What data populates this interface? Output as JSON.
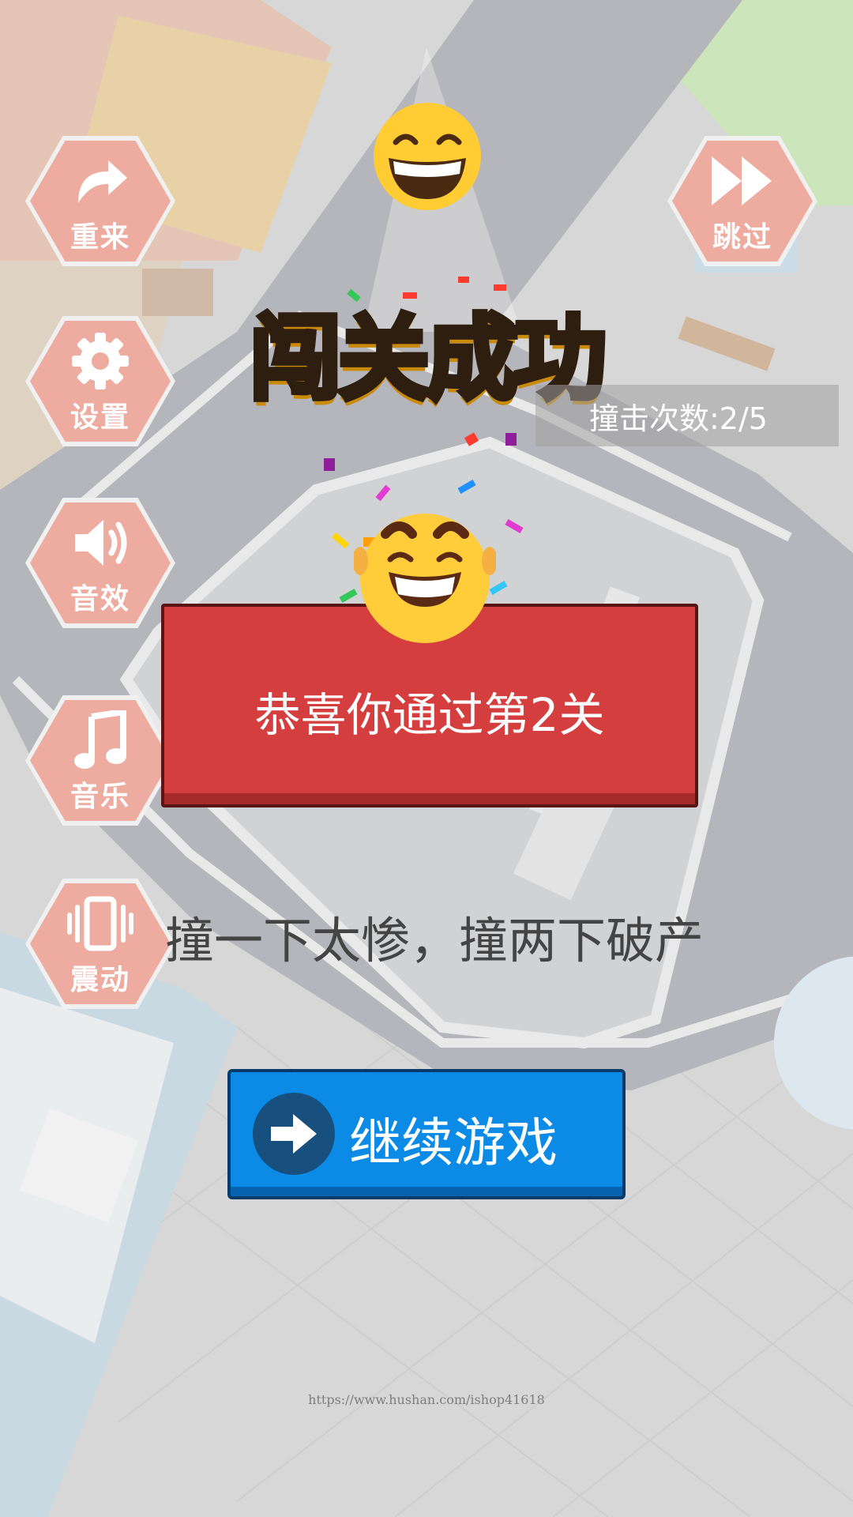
{
  "side_buttons": [
    {
      "label": "重来",
      "icon": "restart-arrow-icon"
    },
    {
      "label": "设置",
      "icon": "gear-icon"
    },
    {
      "label": "音效",
      "icon": "speaker-icon"
    },
    {
      "label": "音乐",
      "icon": "music-note-icon"
    },
    {
      "label": "震动",
      "icon": "vibration-icon"
    }
  ],
  "skip_button": {
    "label": "跳过",
    "icon": "fast-forward-icon"
  },
  "result": {
    "title": "闯关成功",
    "hit_counter": "撞击次数:2/5",
    "banner": "恭喜你通过第2关",
    "tagline": "撞一下太惨，撞两下破产"
  },
  "continue_button": {
    "label": "继续游戏",
    "icon": "arrow-right-icon"
  },
  "watermark": "https://www.hushan.com/ishop41618",
  "colors": {
    "hex_button": "#eeaca0",
    "banner_red": "#d43e3e",
    "continue_blue": "#0b8be6",
    "title_yellow": "#ffe12a"
  }
}
